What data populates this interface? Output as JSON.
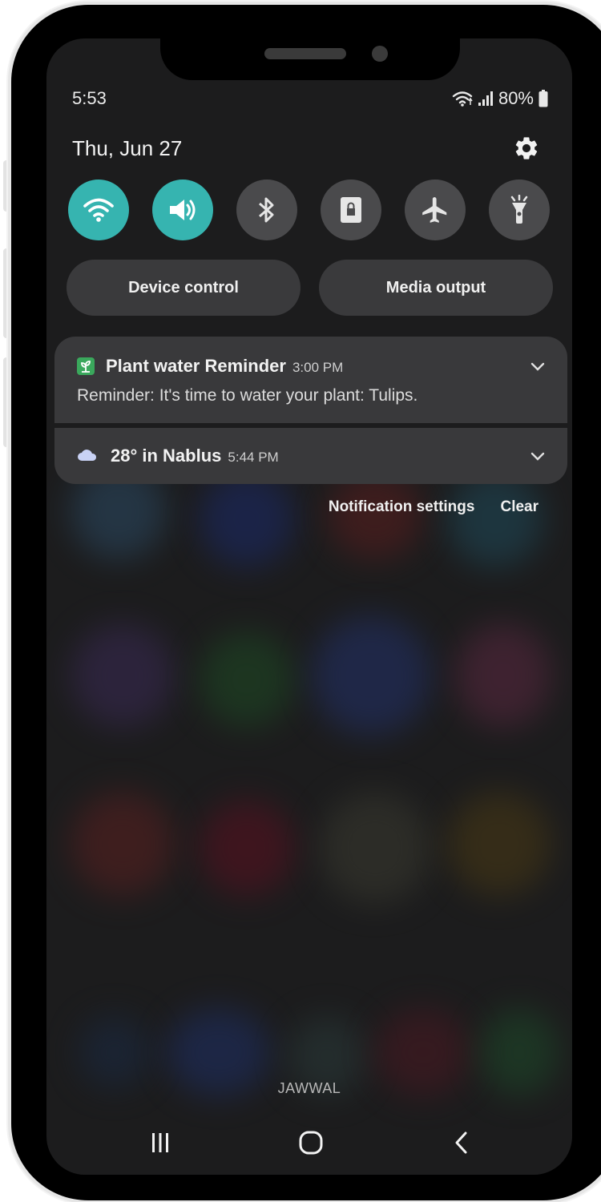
{
  "status_bar": {
    "time": "5:53",
    "battery": "80%"
  },
  "header": {
    "date": "Thu, Jun 27"
  },
  "quick_settings": [
    {
      "name": "wifi",
      "on": true
    },
    {
      "name": "sound",
      "on": true
    },
    {
      "name": "bluetooth",
      "on": false
    },
    {
      "name": "rotation-lock",
      "on": false
    },
    {
      "name": "airplane-mode",
      "on": false
    },
    {
      "name": "flashlight",
      "on": false
    }
  ],
  "pills": {
    "device_control": "Device control",
    "media_output": "Media output"
  },
  "notifications": [
    {
      "app": "Plant water Reminder",
      "time": "3:00 PM",
      "text": "Reminder: It's time to water your plant: Tulips."
    },
    {
      "title": "28° in Nablus",
      "time": "5:44 PM"
    }
  ],
  "actions": {
    "settings": "Notification settings",
    "clear": "Clear"
  },
  "carrier": "JAWWAL",
  "colors": {
    "accent": "#36b4b0",
    "panel": "#39393b",
    "background": "#1c1c1d"
  }
}
